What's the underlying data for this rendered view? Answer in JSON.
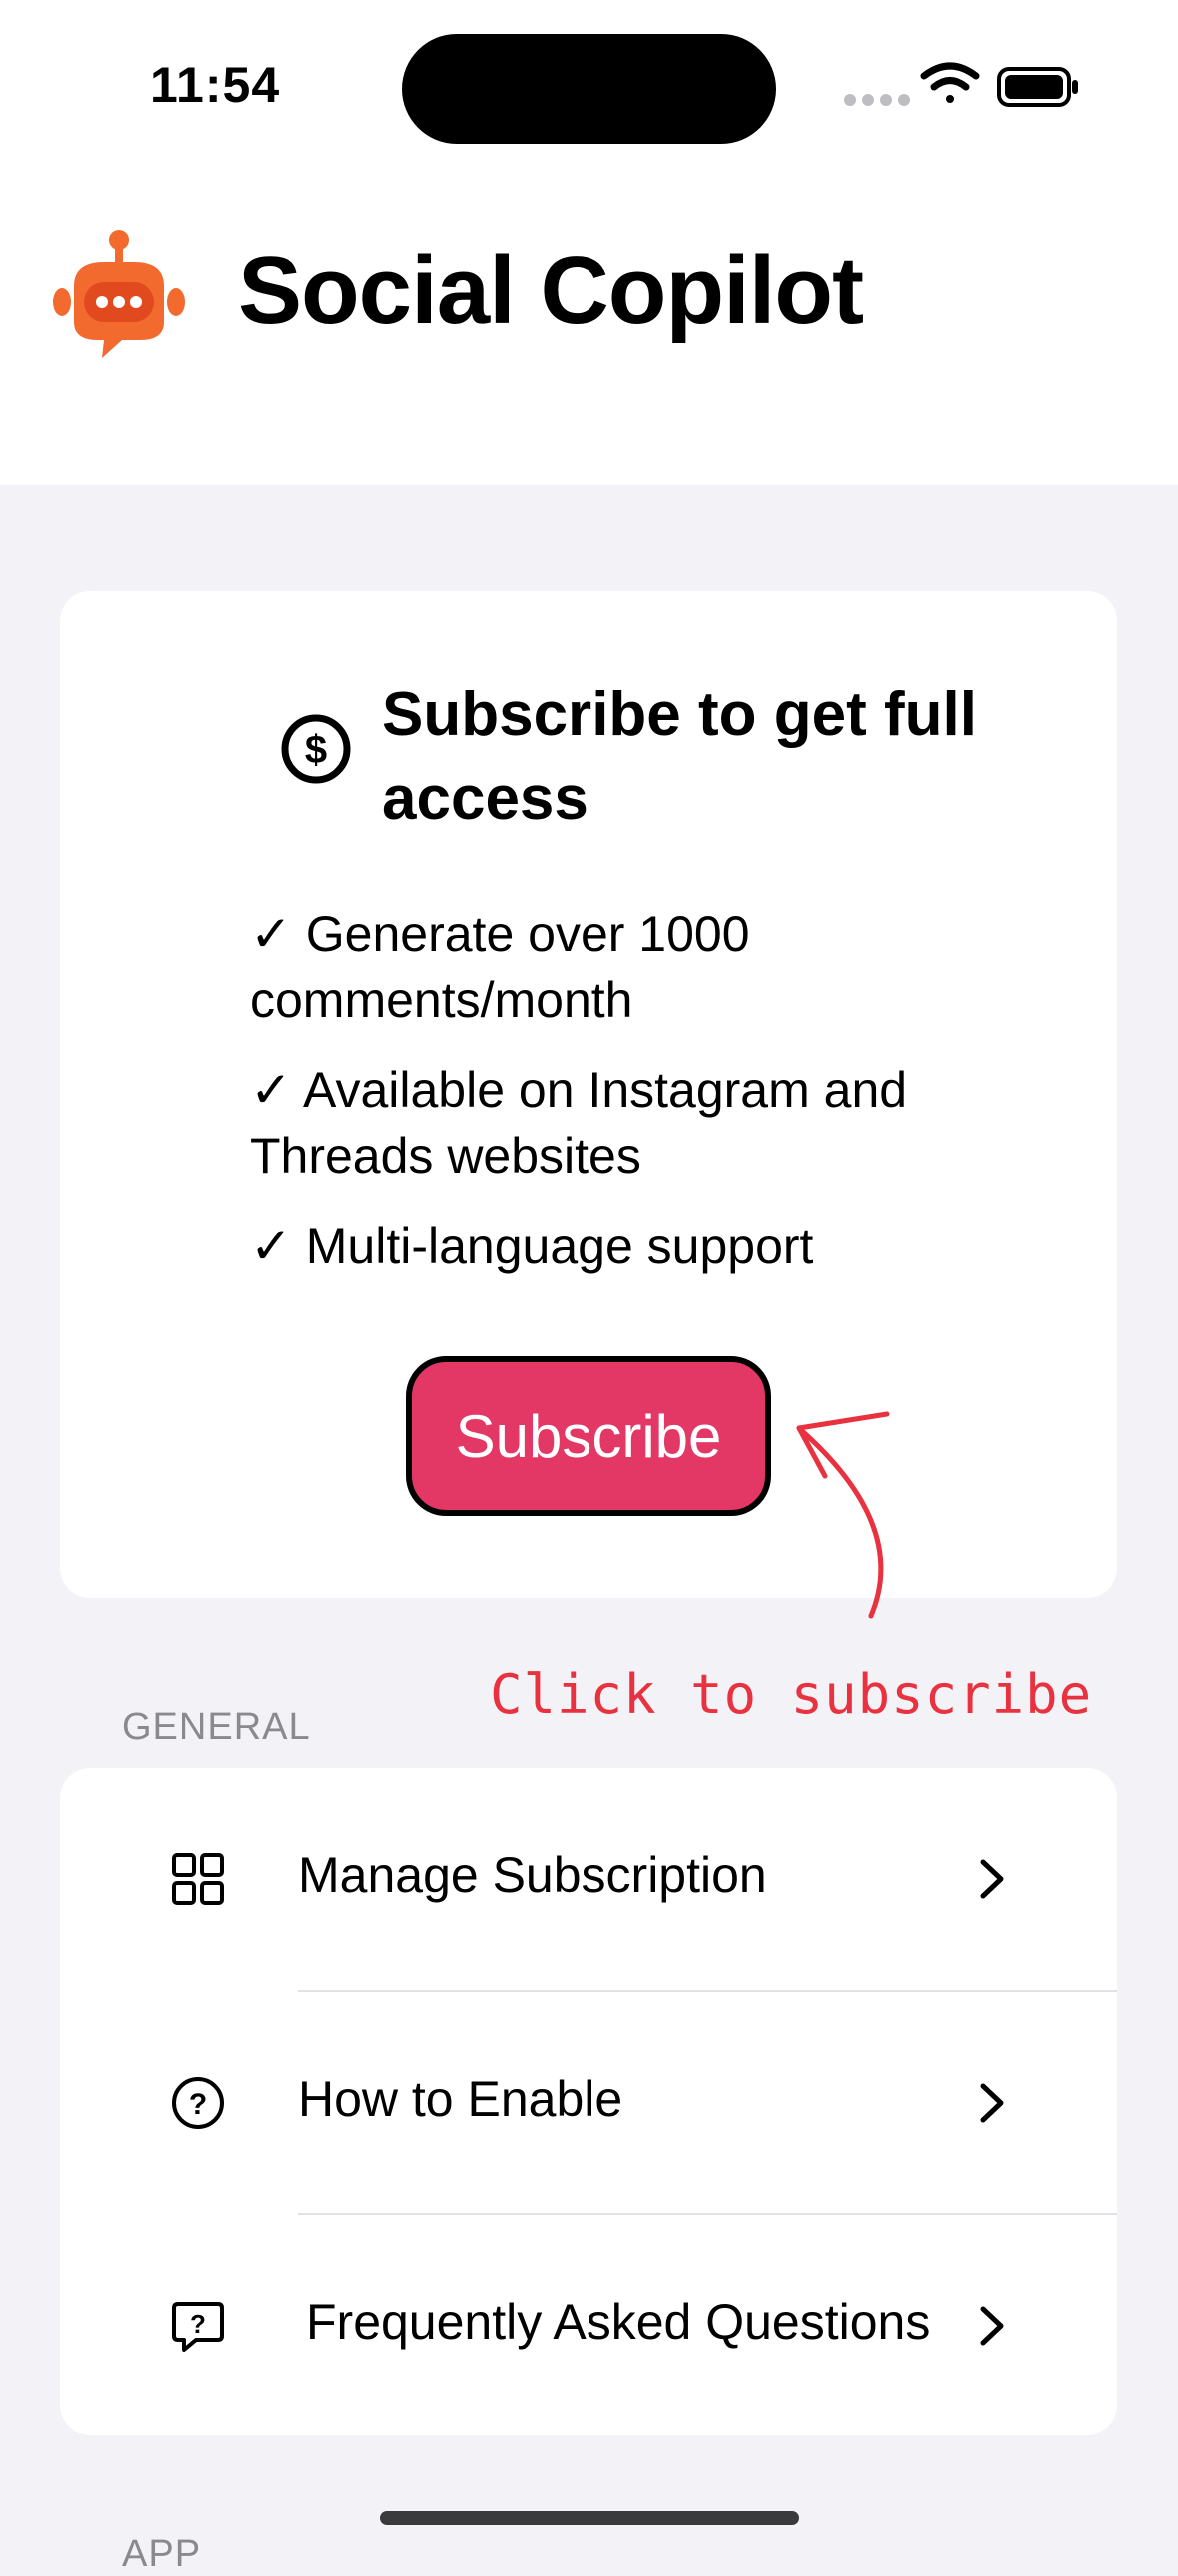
{
  "status_bar": {
    "time": "11:54"
  },
  "header": {
    "app_title": "Social Copilot",
    "logo_icon": "robot-chat-bubble-icon",
    "logo_color": "#f26a2e"
  },
  "subscription_card": {
    "icon": "dollar-circle-icon",
    "title": "Subscribe to get full access",
    "features": [
      "✓ Generate over 1000 comments/month",
      "✓ Available on Instagram and Threads websites",
      "✓ Multi-language support"
    ],
    "button_label": "Subscribe",
    "button_color": "#e33766"
  },
  "annotation": {
    "text": "Click to subscribe",
    "color": "#e8323f"
  },
  "general_section": {
    "header": "GENERAL",
    "items": [
      {
        "label": "Manage Subscription",
        "icon": "grid-icon"
      },
      {
        "label": "How to Enable",
        "icon": "question-circle-icon"
      },
      {
        "label": "Frequently Asked Questions",
        "icon": "question-bubble-icon"
      }
    ]
  },
  "next_section": {
    "header": "APP"
  }
}
